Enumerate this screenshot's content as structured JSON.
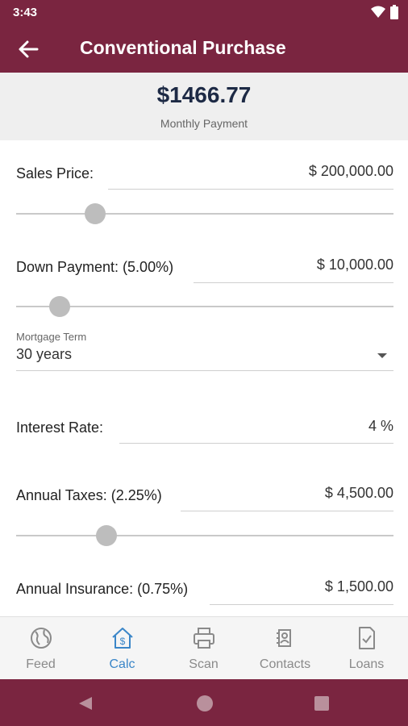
{
  "status_bar": {
    "time": "3:43",
    "icons": [
      "wifi-icon",
      "battery-icon"
    ]
  },
  "app_bar": {
    "title": "Conventional Purchase",
    "back_icon": "back-arrow-icon"
  },
  "summary": {
    "amount": "$1466.77",
    "label": "Monthly Payment"
  },
  "form": {
    "sales_price": {
      "label": "Sales Price:",
      "value": "$ 200,000.00",
      "slider_fraction": 0.21
    },
    "down_payment": {
      "label": "Down Payment: (5.00%)",
      "value": "$ 10,000.00",
      "slider_fraction": 0.115
    },
    "mortgage_term": {
      "label": "Mortgage Term",
      "value": "30 years"
    },
    "interest_rate": {
      "label": "Interest Rate:",
      "value": "4 %"
    },
    "annual_taxes": {
      "label": "Annual Taxes: (2.25%)",
      "value": "$ 4,500.00",
      "slider_fraction": 0.24
    },
    "annual_insurance": {
      "label": "Annual Insurance: (0.75%)",
      "value": "$ 1,500.00"
    }
  },
  "bottom_nav": {
    "active": "calc",
    "items": [
      {
        "id": "feed",
        "label": "Feed",
        "icon": "globe-icon"
      },
      {
        "id": "calc",
        "label": "Calc",
        "icon": "house-dollar-icon"
      },
      {
        "id": "scan",
        "label": "Scan",
        "icon": "printer-icon"
      },
      {
        "id": "contacts",
        "label": "Contacts",
        "icon": "contacts-icon"
      },
      {
        "id": "loans",
        "label": "Loans",
        "icon": "document-check-icon"
      }
    ]
  },
  "colors": {
    "brand": "#7a2540",
    "accent": "#3a86c8",
    "amount": "#1d2a45"
  }
}
